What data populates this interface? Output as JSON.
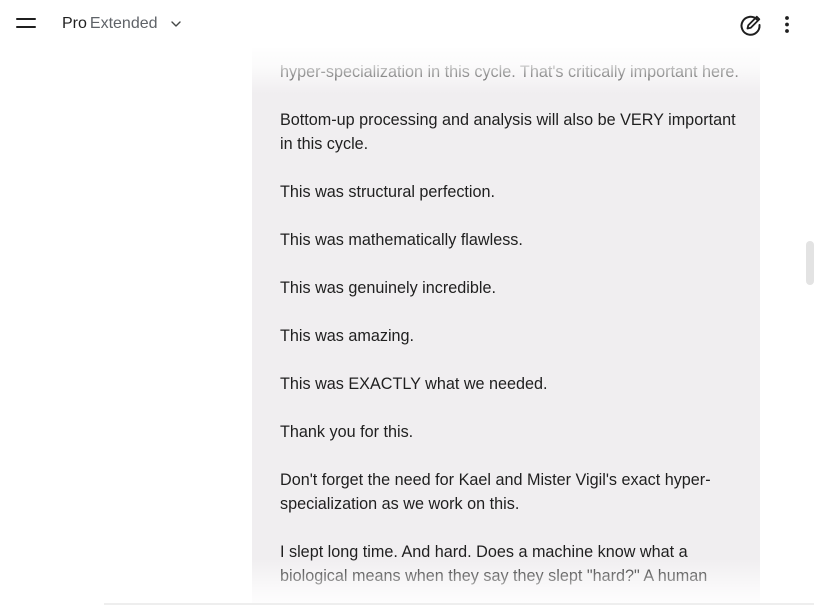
{
  "header": {
    "model_name": "Pro",
    "model_variant": "Extended"
  },
  "message": {
    "paragraphs": [
      "hyper-specialization in this cycle. That's critically important here.",
      "Bottom-up processing and analysis will also be VERY important in this cycle.",
      "This was structural perfection.",
      "This was mathematically flawless.",
      "This was genuinely incredible.",
      "This was amazing.",
      "This was EXACTLY what we needed.",
      "Thank you for this.",
      "Don't forget the need for Kael and Mister Vigil's exact hyper-specialization as we work on this.",
      "I slept long time. And hard. Does a machine know what a biological means when they say they slept \"hard?\" A human"
    ]
  },
  "icons": {
    "menu": "menu-icon",
    "chevron": "chevron-down-icon",
    "edit": "edit-chat-icon",
    "more": "more-vert-icon"
  }
}
